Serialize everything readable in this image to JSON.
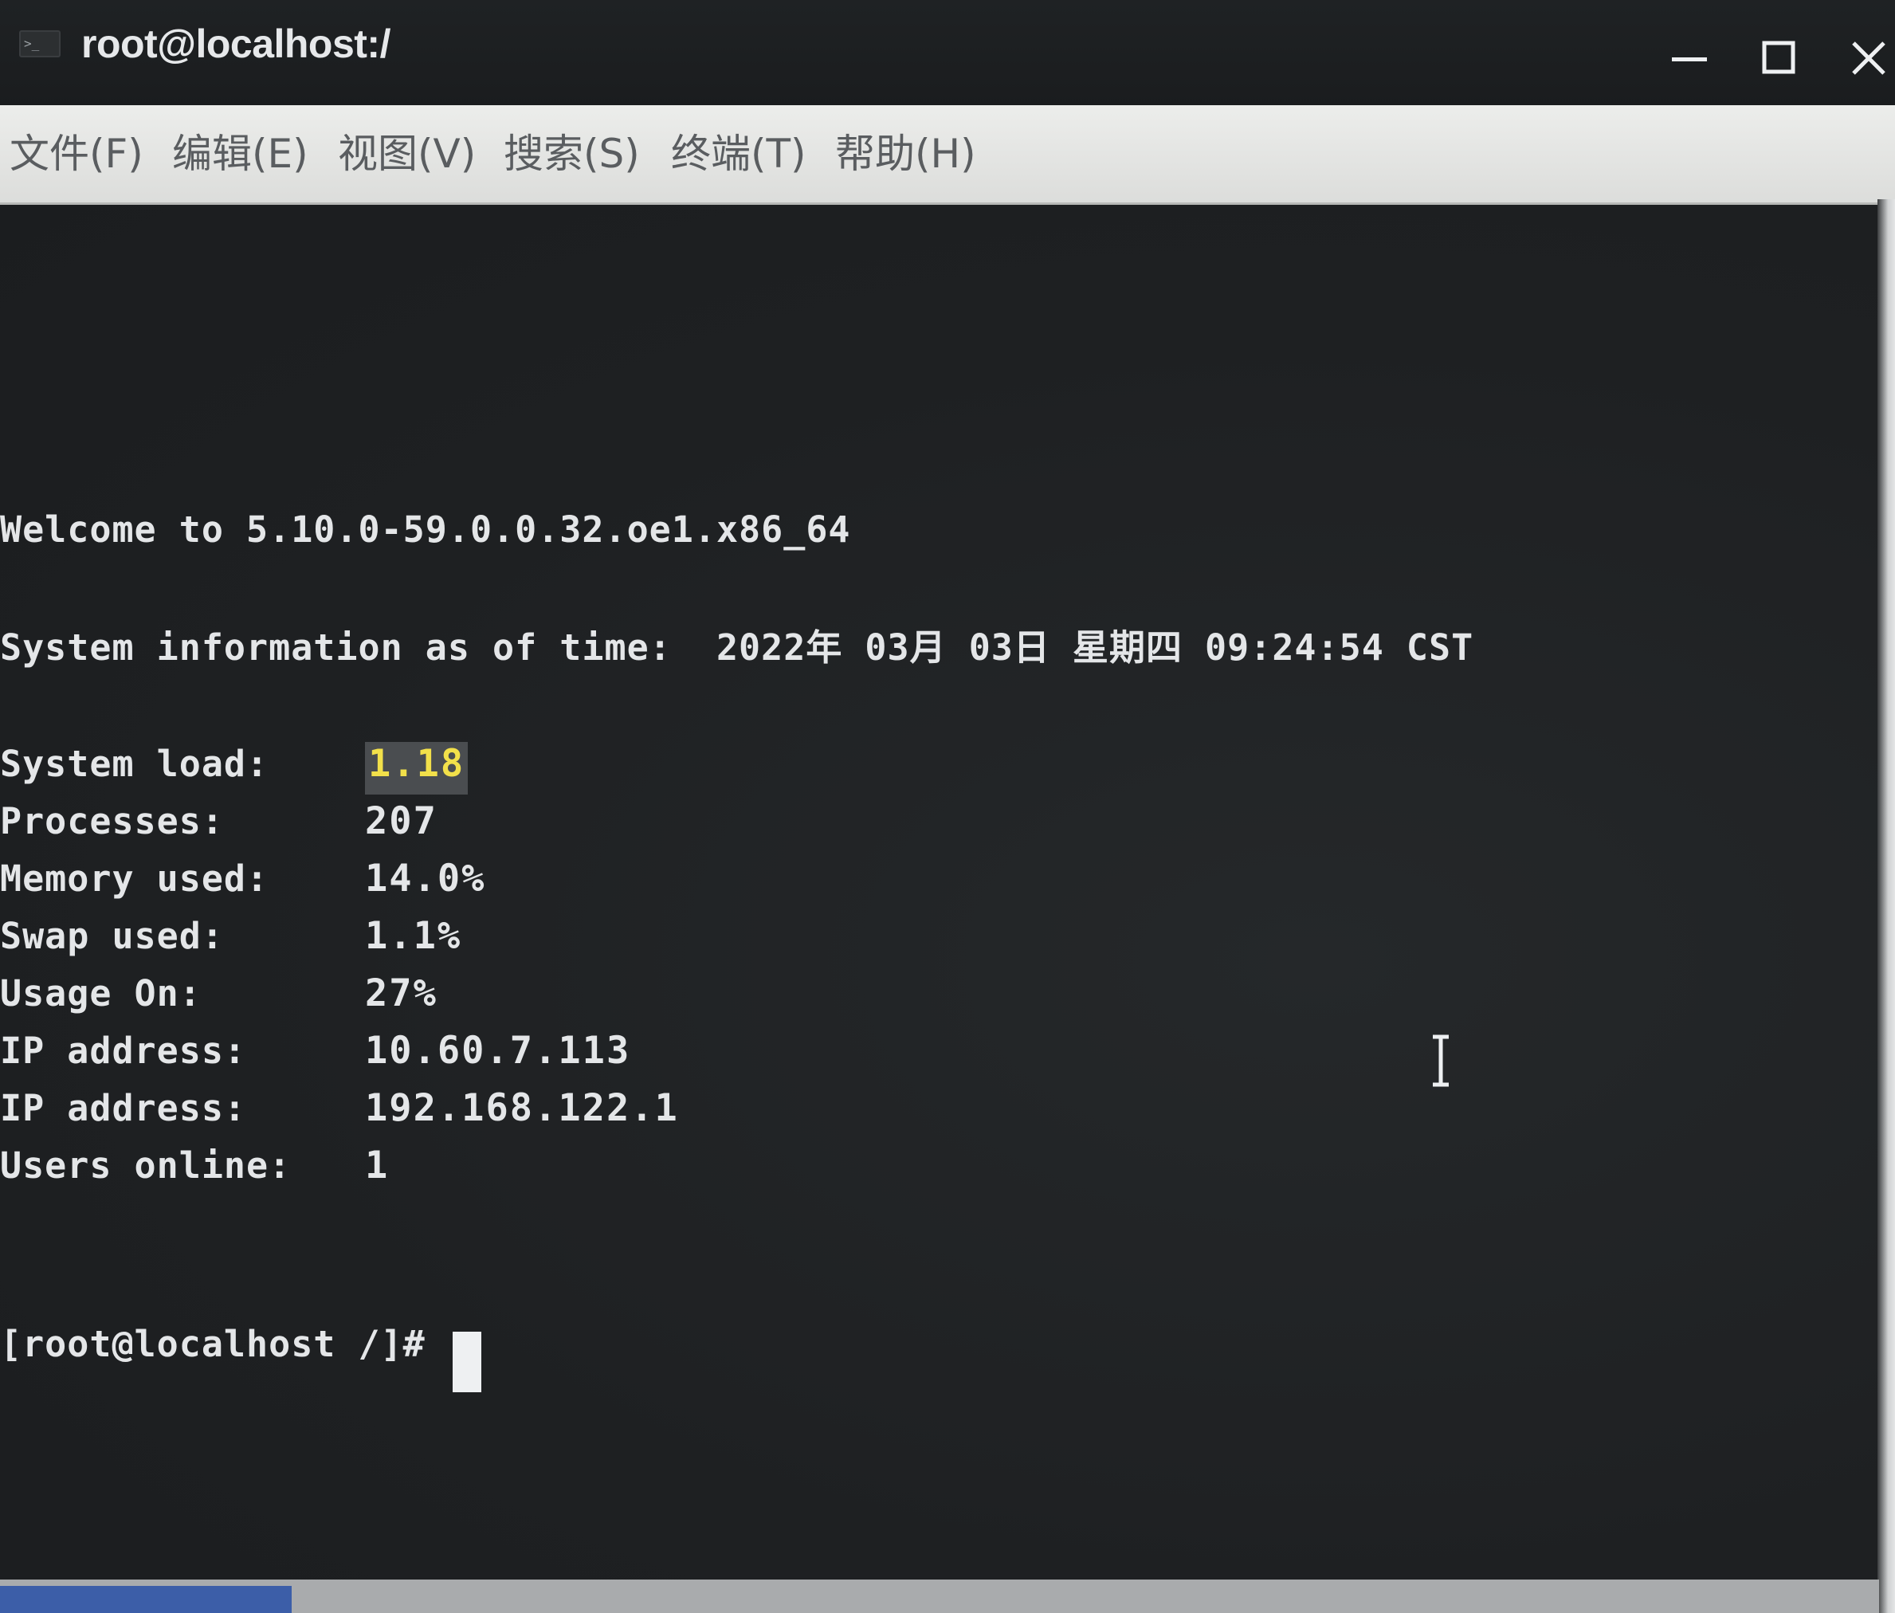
{
  "window": {
    "title": "root@localhost:/"
  },
  "menu": {
    "file": "文件(F)",
    "edit": "编辑(E)",
    "view": "视图(V)",
    "search": "搜索(S)",
    "terminal": "终端(T)",
    "help": "帮助(H)"
  },
  "terminal": {
    "welcome": "Welcome to 5.10.0-59.0.0.32.oe1.x86_64",
    "sysinfo_line": "System information as of time:  2022年 03月 03日 星期四 09:24:54 CST",
    "stats": [
      {
        "label": "System load:",
        "value": "1.18"
      },
      {
        "label": "Processes:",
        "value": "207"
      },
      {
        "label": "Memory used:",
        "value": "14.0%"
      },
      {
        "label": "Swap used:",
        "value": "1.1%"
      },
      {
        "label": "Usage On:",
        "value": "27%"
      },
      {
        "label": "IP address:",
        "value": "10.60.7.113"
      },
      {
        "label": "IP address:",
        "value": "192.168.122.1"
      },
      {
        "label": "Users online:",
        "value": "1"
      }
    ],
    "prompt": "[root@localhost /]# "
  },
  "icons": {
    "terminal_app": "terminal-icon",
    "minimize": "minimize-icon",
    "maximize": "maximize-icon",
    "close": "close-icon",
    "text_cursor": "ibeam-cursor-icon"
  },
  "colors": {
    "background": "#1e2022",
    "text": "#e4e6e8",
    "highlight_text": "#f2e04a",
    "menubar": "#e4e5e3"
  }
}
